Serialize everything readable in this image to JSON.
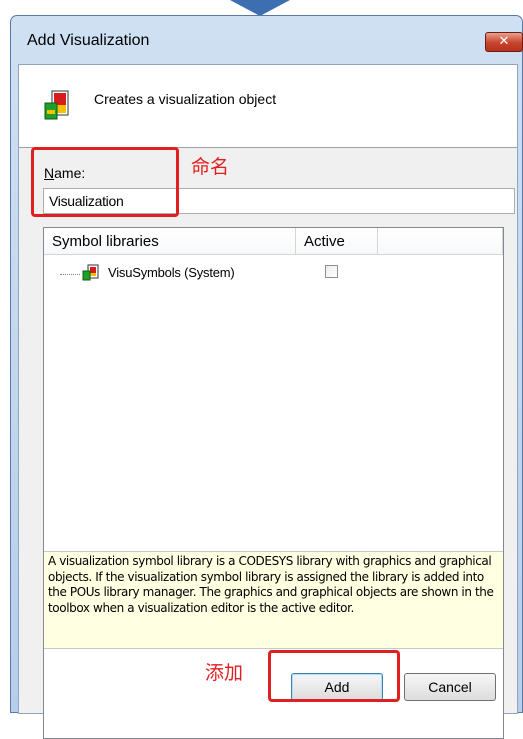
{
  "dialog": {
    "title": "Add Visualization",
    "close_glyph": "✕",
    "header_description": "Creates a visualization object",
    "header_icon": "visualization-icon"
  },
  "name_field": {
    "label_accel": "N",
    "label_rest": "ame:",
    "value": "Visualization"
  },
  "libraries": {
    "columns": [
      "Symbol libraries",
      "Active"
    ],
    "items": [
      {
        "label": "VisuSymbols (System)",
        "icon": "library-icon",
        "active": false
      }
    ],
    "info": "A visualization symbol library is a CODESYS library with graphics and graphical objects. If the visualization symbol library is assigned the library is added into the POUs library manager. The graphics and graphical objects are shown in the toolbox when a visualization editor is the active editor."
  },
  "buttons": {
    "add": "Add",
    "cancel": "Cancel"
  },
  "annotations": {
    "name_note": "命名",
    "add_note": "添加",
    "color": "#e02020"
  },
  "colors": {
    "pointer": "#3d6fb0",
    "info_background": "#ffffe1",
    "close_button": "#c7432b"
  }
}
